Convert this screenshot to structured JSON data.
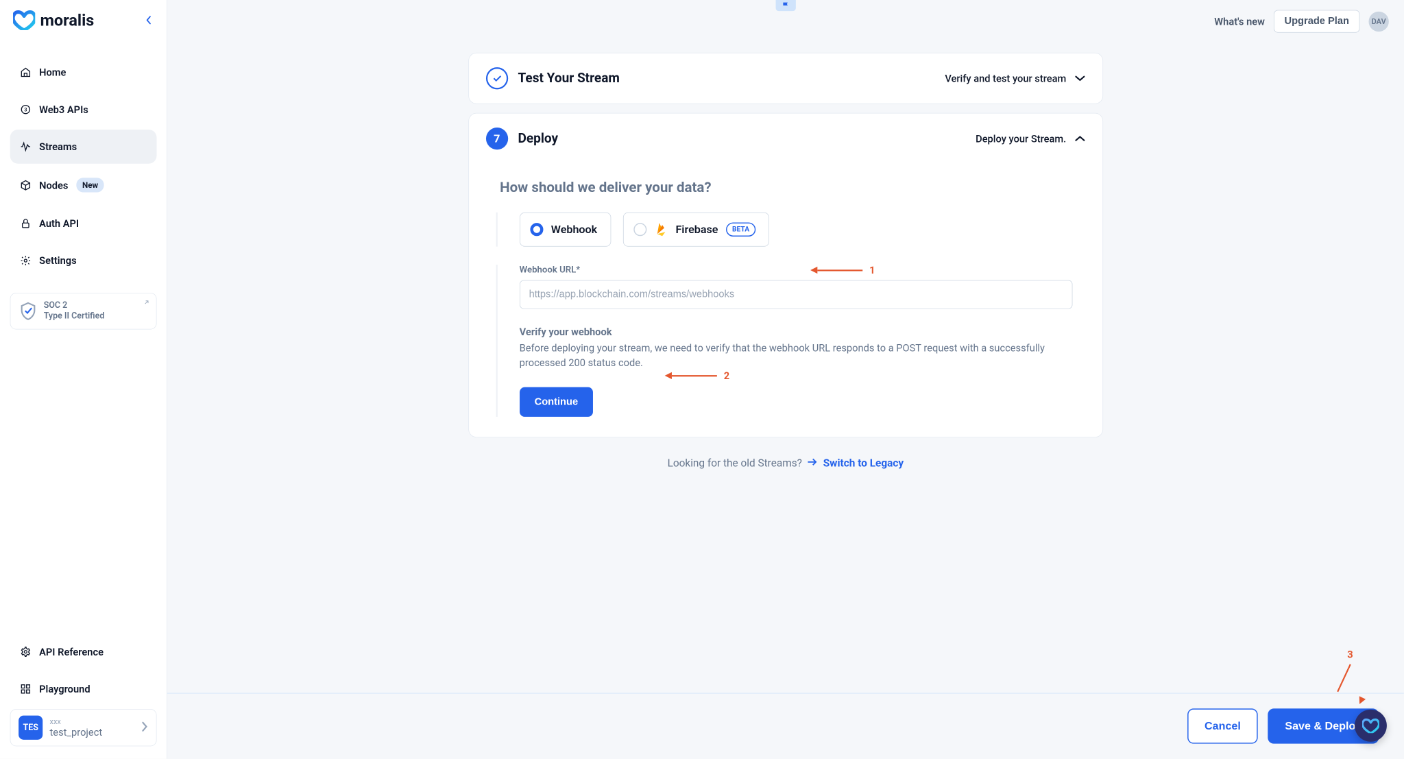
{
  "brand": "moralis",
  "sidebar": {
    "items": [
      {
        "label": "Home"
      },
      {
        "label": "Web3 APIs"
      },
      {
        "label": "Streams"
      },
      {
        "label": "Nodes",
        "badge": "New"
      },
      {
        "label": "Auth API"
      },
      {
        "label": "Settings"
      }
    ],
    "soc": {
      "line1": "SOC 2",
      "line2": "Type II Certified"
    },
    "bottom": [
      {
        "label": "API Reference"
      },
      {
        "label": "Playground"
      }
    ],
    "project": {
      "badge": "TES",
      "sub": "xxx",
      "name": "test_project"
    }
  },
  "header": {
    "whats_new": "What's new",
    "upgrade": "Upgrade Plan",
    "avatar": "DAV"
  },
  "cards": {
    "test": {
      "title": "Test Your Stream",
      "subtitle": "Verify and test your stream"
    },
    "deploy": {
      "step": "7",
      "title": "Deploy",
      "subtitle": "Deploy your Stream.",
      "heading": "How should we deliver your data?",
      "optionWebhook": "Webhook",
      "optionFirebase": "Firebase",
      "beta": "BETA",
      "fieldLabel": "Webhook URL*",
      "placeholder": "https://app.blockchain.com/streams/webhooks",
      "verifyTitle": "Verify your webhook",
      "verifyText": "Before deploying your stream, we need to verify that the webhook URL responds to a POST request with a successfully processed 200 status code.",
      "continue": "Continue"
    }
  },
  "legacy": {
    "text": "Looking for the old Streams?",
    "link": "Switch to Legacy"
  },
  "footer": {
    "cancel": "Cancel",
    "save": "Save & Deploy"
  },
  "annotations": {
    "a1": "1",
    "a2": "2",
    "a3": "3"
  }
}
